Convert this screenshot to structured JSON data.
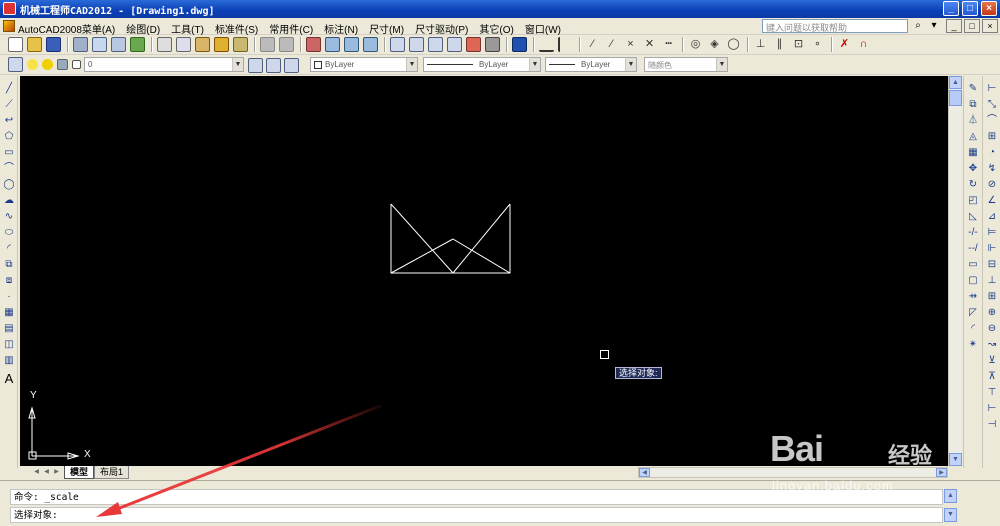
{
  "window": {
    "title": "机械工程师CAD2012 - [Drawing1.dwg]",
    "minimize_glyph": "_",
    "maximize_glyph": "□",
    "close_glyph": "×"
  },
  "menu": {
    "items": [
      "AutoCAD2008菜单(A)",
      "绘图(D)",
      "工具(T)",
      "标准件(S)",
      "常用件(C)",
      "标注(N)",
      "尺寸(M)",
      "尺寸驱动(P)",
      "其它(O)",
      "窗口(W)"
    ],
    "help_placeholder": "键入问题以获取帮助",
    "doc_buttons": [
      "_",
      "□",
      "×"
    ]
  },
  "layers_toolbar": {
    "layer_value": "0",
    "color_value": "ByLayer",
    "linetype_value": "ByLayer",
    "lineweight_value": "ByLayer",
    "plotstyle_value": "随颜色"
  },
  "drawing": {
    "tooltip": "选择对象:",
    "ucs_y": "Y",
    "ucs_x": "X"
  },
  "tabs": {
    "model": "模型",
    "layout1": "布局1"
  },
  "command": {
    "line1": "命令: _scale",
    "line2": "选择对象:"
  },
  "watermark": {
    "logo": "Bai",
    "logo_cn": "经验",
    "sub": "jingyan.baidu.com"
  },
  "annotation": {
    "arrow_color": "#e8383a"
  },
  "colors": {
    "titlebar": "#0a3fb5",
    "canvas": "#000000",
    "chrome": "#ece9d8",
    "tooltip_bg": "#1f2a58"
  }
}
